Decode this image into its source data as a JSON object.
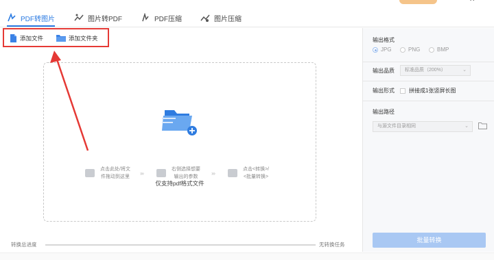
{
  "tabs": [
    {
      "label": "PDF转图片",
      "icon": "pdf-icon",
      "active": true
    },
    {
      "label": "图片转PDF",
      "icon": "image-to-pdf-icon",
      "active": false
    },
    {
      "label": "PDF压缩",
      "icon": "pdf-compress-icon",
      "active": false
    },
    {
      "label": "图片压缩",
      "icon": "image-compress-icon",
      "active": false
    }
  ],
  "toolbar": {
    "add_file_label": "添加文件",
    "add_folder_label": "添加文件夹"
  },
  "dropzone": {
    "hint": "仅支持pdf格式文件",
    "steps": [
      {
        "line1": "点击此处/将文",
        "line2": "件拖动到这里"
      },
      {
        "line1": "右侧选择想要",
        "line2": "输出的参数"
      },
      {
        "line1": "点击<转换>/",
        "line2": "<批量转换>"
      }
    ],
    "arrow_glyph": "›››"
  },
  "progress": {
    "label": "转换总进度",
    "status": "无转换任务",
    "fraction": 0
  },
  "settings": {
    "output_format_label": "输出格式",
    "formats": [
      {
        "label": "JPG",
        "selected": true
      },
      {
        "label": "PNG",
        "selected": false
      },
      {
        "label": "BMP",
        "selected": false
      }
    ],
    "quality_label": "输出品质",
    "quality_value": "标准品质（200%）",
    "form_label": "输出形式",
    "form_option": "拼接成1张竖屏长图",
    "path_label": "输出路径",
    "path_value": "与源文件目录相同",
    "batch_button": "批量转换"
  },
  "colors": {
    "accent": "#2a7ae2",
    "highlight_box": "#e53935",
    "button_disabled": "#a9c8f3"
  }
}
